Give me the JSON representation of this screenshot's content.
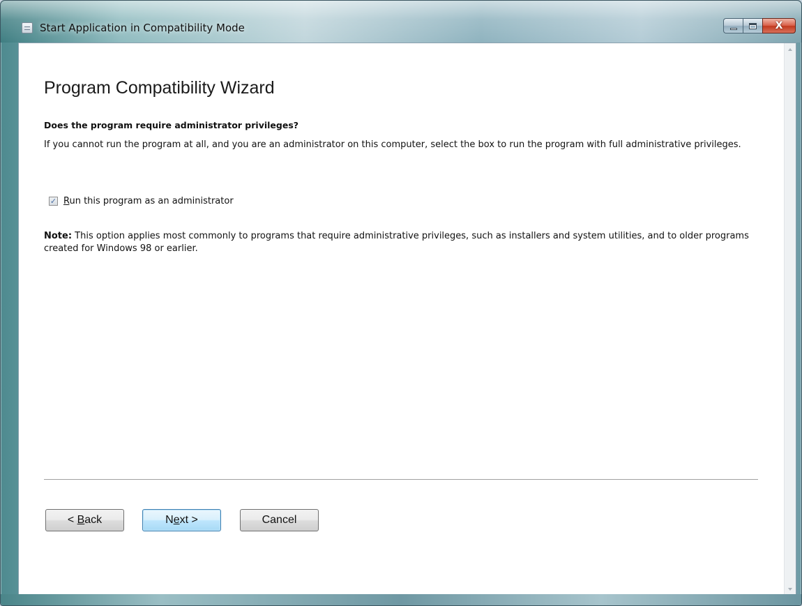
{
  "window": {
    "title": "Start Application in Compatibility Mode",
    "minimize_label": "",
    "maximize_label": "",
    "close_label": "X"
  },
  "wizard": {
    "title": "Program Compatibility Wizard",
    "question": "Does the program require administrator privileges?",
    "description": "If you cannot run the program at all, and you are an administrator on this computer, select the box to run the program with full administrative privileges.",
    "checkbox": {
      "label_mnemonic": "R",
      "label_rest": "un this program as an administrator",
      "checked": true
    },
    "note": {
      "label": "Note:",
      "text": " This option applies most commonly to programs that require administrative privileges, such as installers and system utilities, and to older programs created for Windows 98 or earlier."
    }
  },
  "buttons": {
    "back": {
      "prefix": "< ",
      "mnemonic": "B",
      "rest": "ack"
    },
    "next": {
      "prefix": "N",
      "mnemonic": "e",
      "rest": "xt >"
    },
    "cancel": {
      "label": "Cancel"
    }
  },
  "icons": {
    "app": "application-window-icon",
    "check": "check-mark-icon",
    "scroll_up": "scroll-up-arrow-icon",
    "scroll_down": "scroll-down-arrow-icon"
  }
}
